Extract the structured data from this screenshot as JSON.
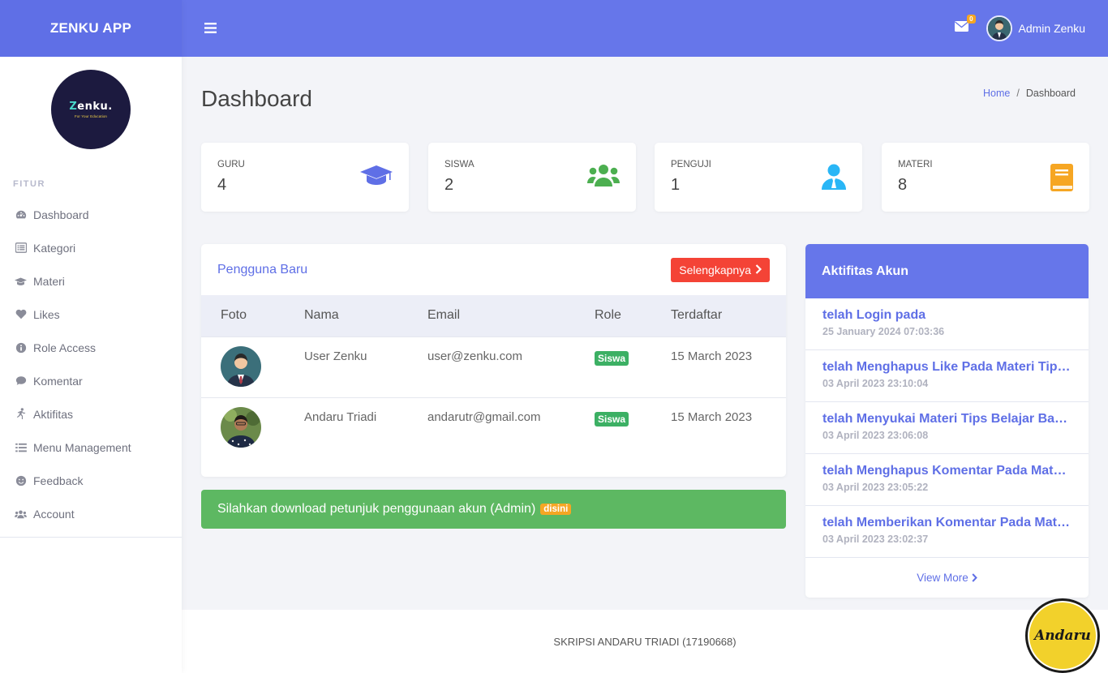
{
  "brand": {
    "name": "ZENKU APP"
  },
  "logo": {
    "main_prefix": "Z",
    "main_rest": "enku.",
    "sub": "For Your Education"
  },
  "sidebar": {
    "heading": "FITUR",
    "items": [
      {
        "label": "Dashboard",
        "icon": "tachometer-icon"
      },
      {
        "label": "Kategori",
        "icon": "list-alt-icon"
      },
      {
        "label": "Materi",
        "icon": "graduation-cap-icon"
      },
      {
        "label": "Likes",
        "icon": "heart-icon"
      },
      {
        "label": "Role Access",
        "icon": "info-circle-icon"
      },
      {
        "label": "Komentar",
        "icon": "comment-icon"
      },
      {
        "label": "Aktifitas",
        "icon": "running-icon"
      },
      {
        "label": "Menu Management",
        "icon": "list-icon"
      },
      {
        "label": "Feedback",
        "icon": "smile-icon"
      },
      {
        "label": "Account",
        "icon": "users-icon"
      }
    ]
  },
  "topbar": {
    "mail_count": "0",
    "user_name": "Admin Zenku"
  },
  "page": {
    "title": "Dashboard",
    "breadcrumb": {
      "home": "Home",
      "separator": "/",
      "current": "Dashboard"
    }
  },
  "stats": [
    {
      "label": "GURU",
      "value": "4",
      "icon": "graduation-cap-icon",
      "color": "#5f6fe6"
    },
    {
      "label": "SISWA",
      "value": "2",
      "icon": "users-icon",
      "color": "#4caf50"
    },
    {
      "label": "PENGUJI",
      "value": "1",
      "icon": "user-tie-icon",
      "color": "#29b6f6"
    },
    {
      "label": "MATERI",
      "value": "8",
      "icon": "book-icon",
      "color": "#f6a623"
    }
  ],
  "users": {
    "title": "Pengguna Baru",
    "button": "Selengkapnya",
    "columns": [
      "Foto",
      "Nama",
      "Email",
      "Role",
      "Terdaftar"
    ],
    "rows": [
      {
        "nama": "User Zenku",
        "email": "user@zenku.com",
        "role": "Siswa",
        "terdaftar": "15 March 2023"
      },
      {
        "nama": "Andaru Triadi",
        "email": "andarutr@gmail.com",
        "role": "Siswa",
        "terdaftar": "15 March 2023"
      }
    ]
  },
  "alert": {
    "text": "Silahkan download petunjuk penggunaan akun (Admin)",
    "badge": "disini"
  },
  "activity": {
    "title": "Aktifitas Akun",
    "items": [
      {
        "title": "telah Login pada",
        "time": "25 January 2024 07:03:36"
      },
      {
        "title": "telah Menghapus Like Pada Materi Tips B...",
        "time": "03 April 2023 23:10:04"
      },
      {
        "title": "telah Menyukai Materi Tips Belajar Bahas...",
        "time": "03 April 2023 23:06:08"
      },
      {
        "title": "telah Menghapus Komentar Pada Materi ...",
        "time": "03 April 2023 23:05:22"
      },
      {
        "title": "telah Memberikan Komentar Pada Materi ...",
        "time": "03 April 2023 23:02:37"
      }
    ],
    "view_more": "View More"
  },
  "footer": {
    "text": "SKRIPSI ANDARU TRIADI (17190668)"
  },
  "watermark": {
    "text": "Andaru"
  }
}
